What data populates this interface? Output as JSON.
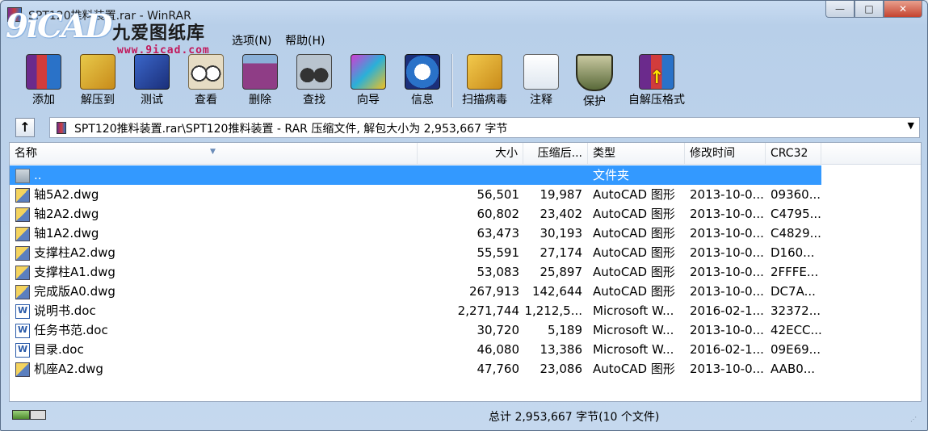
{
  "window": {
    "title": "SPT120推料装置.rar - WinRAR",
    "controls": {
      "minimize": "—",
      "maximize": "□",
      "close": "✕"
    }
  },
  "logo": {
    "mark": "9iCAD",
    "name": "九爱图纸库",
    "url": "www.9icad.com"
  },
  "menu": [
    {
      "label": "选项(N)"
    },
    {
      "label": "帮助(H)"
    }
  ],
  "toolbar": [
    {
      "label": "添加",
      "icon": "add-icon"
    },
    {
      "label": "解压到",
      "icon": "extract-to-icon"
    },
    {
      "label": "测试",
      "icon": "test-icon"
    },
    {
      "label": "查看",
      "icon": "view-icon"
    },
    {
      "label": "删除",
      "icon": "delete-icon"
    },
    {
      "label": "查找",
      "icon": "find-icon"
    },
    {
      "label": "向导",
      "icon": "wizard-icon"
    },
    {
      "label": "信息",
      "icon": "info-icon"
    },
    {
      "label": "扫描病毒",
      "icon": "virus-scan-icon"
    },
    {
      "label": "注释",
      "icon": "comment-icon"
    },
    {
      "label": "保护",
      "icon": "protect-icon"
    },
    {
      "label": "自解压格式",
      "icon": "sfx-icon"
    }
  ],
  "address": {
    "up_icon": "↑",
    "path": "SPT120推料装置.rar\\SPT120推料装置 - RAR 压缩文件, 解包大小为 2,953,667 字节",
    "dropdown_icon": "▼"
  },
  "columns": {
    "name": "名称",
    "size": "大小",
    "packed": "压缩后...",
    "type": "类型",
    "modified": "修改时间",
    "crc": "CRC32"
  },
  "files": [
    {
      "name": "..",
      "size": "",
      "packed": "",
      "type": "文件夹",
      "modified": "",
      "crc": "",
      "icon": "folder",
      "selected": true
    },
    {
      "name": "轴5A2.dwg",
      "size": "56,501",
      "packed": "19,987",
      "type": "AutoCAD 图形",
      "modified": "2013-10-0...",
      "crc": "09360...",
      "icon": "dwg"
    },
    {
      "name": "轴2A2.dwg",
      "size": "60,802",
      "packed": "23,402",
      "type": "AutoCAD 图形",
      "modified": "2013-10-0...",
      "crc": "C4795...",
      "icon": "dwg"
    },
    {
      "name": "轴1A2.dwg",
      "size": "63,473",
      "packed": "30,193",
      "type": "AutoCAD 图形",
      "modified": "2013-10-0...",
      "crc": "C4829...",
      "icon": "dwg"
    },
    {
      "name": "支撑柱A2.dwg",
      "size": "55,591",
      "packed": "27,174",
      "type": "AutoCAD 图形",
      "modified": "2013-10-0...",
      "crc": "D160...",
      "icon": "dwg"
    },
    {
      "name": "支撑柱A1.dwg",
      "size": "53,083",
      "packed": "25,897",
      "type": "AutoCAD 图形",
      "modified": "2013-10-0...",
      "crc": "2FFFE...",
      "icon": "dwg"
    },
    {
      "name": "完成版A0.dwg",
      "size": "267,913",
      "packed": "142,644",
      "type": "AutoCAD 图形",
      "modified": "2013-10-0...",
      "crc": "DC7A...",
      "icon": "dwg"
    },
    {
      "name": "说明书.doc",
      "size": "2,271,744",
      "packed": "1,212,5...",
      "type": "Microsoft W...",
      "modified": "2016-02-1...",
      "crc": "32372...",
      "icon": "doc"
    },
    {
      "name": "任务书范.doc",
      "size": "30,720",
      "packed": "5,189",
      "type": "Microsoft W...",
      "modified": "2013-10-0...",
      "crc": "42ECC...",
      "icon": "doc"
    },
    {
      "name": "目录.doc",
      "size": "46,080",
      "packed": "13,386",
      "type": "Microsoft W...",
      "modified": "2016-02-1...",
      "crc": "09E69...",
      "icon": "doc"
    },
    {
      "name": "机座A2.dwg",
      "size": "47,760",
      "packed": "23,086",
      "type": "AutoCAD 图形",
      "modified": "2013-10-0...",
      "crc": "AAB0...",
      "icon": "dwg"
    }
  ],
  "status": {
    "text": "总计 2,953,667 字节(10 个文件)",
    "grip": "⋰"
  }
}
